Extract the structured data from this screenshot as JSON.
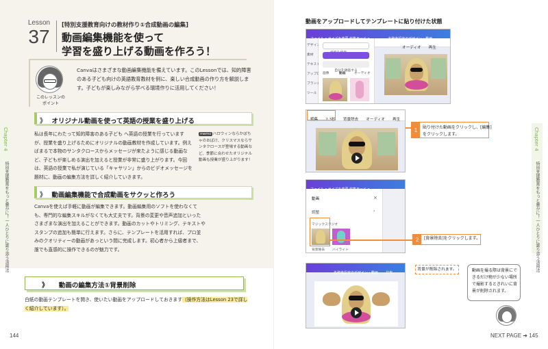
{
  "lesson": {
    "label": "Lesson",
    "number": "37",
    "subtitle": "[特別支援教育向けの教材作り①合成動画の編集]",
    "title_line1": "動画編集機能を使って",
    "title_line2": "学習を盛り上げる動画を作ろう！"
  },
  "intro": {
    "text": "Canvaはさまざまな動画編集機能を備えています。このLessonでは、知的障害のある子ども向けの英語教育教材を例に、楽しい合成動画の作り方を解説します。子どもが楽しみながら学べる環境作りに活用してください！",
    "point_label": "このレッスンのポイント"
  },
  "section1": {
    "mark": "》",
    "title": "オリジナル動画を使って英語の授業を盛り上げる",
    "body": "私は長年にわたって知的障害のある子ども へ英語の授業を行っていますが、授業を盛り上げるためにオリジナルの動画教材を作成しています。例えばまるで本物のサンタクロースからメッセージが来たように感じる動画など、子どもが楽しめる演出を加えると授業が非常に盛り上がります。今回は、英語の授業で私が演じている「キャサリン」からのビデオメッセージを題材に、動画の編集方法を詳しく紹介していきます。",
    "memo_tag": "memo",
    "memo": "ハロウィンならかぼちゃのおばけ、クリスマスならサンタクロースが登場する動画など、季節に合わせたオリジナル動画も授業が盛り上がります！"
  },
  "section2": {
    "mark": "》",
    "title": "動画編集機能で合成動画をサクッと作ろう",
    "body": "Canvaを使えば手軽に動画が編集できます。動画編集用のソフトを使わなくても、専門的な編集スキルがなくても大丈夫です。背景の変更や音声追加といったさまざまな演出を加えることができます。動画のカットやトリミング、テキストやスタンプの追加も簡単に行えます。さらに、テンプレートを活用すれば、プロ並みのクオリティーの動画があっという間に完成します。初心者から上級者まで、誰でも直感的に操作できるのが魅力です。"
  },
  "section3": {
    "mark": "》",
    "title": "動画の編集方法①背景削除",
    "body_line1": "白紙の動画テンプレートを開き、使いたい動画をアップロードしておきます",
    "body_highlight": "（操作方法はLesson 23で詳しく紹介しています）。"
  },
  "chapter": {
    "label": "Chapter 4",
    "description": "特別支援教育をもっと豊かに！一人ひとりに寄り添う活用法"
  },
  "folio": {
    "left": "144",
    "right_next": "NEXT PAGE",
    "right_arrow": "➜",
    "right": "145"
  },
  "right": {
    "title": "動画をアップロードしてテンプレートに貼り付けた状態",
    "shot1": {
      "bar": "ファイル ▾ サイズを変更  編集モード ▾",
      "doc_title": "名称未設定のデザイン・動画",
      "search_placeholder": "検索を検索",
      "upload_button": "ファイルをアップロード",
      "record_button": "自分を録画する",
      "tabs": [
        "画像",
        "動画",
        "オーディオ"
      ],
      "side_items": [
        "デザイン",
        "素材",
        "テキスト",
        "アップロード",
        "ブランド",
        "ツール"
      ],
      "toolbar": [
        "オーディオ",
        "再生"
      ]
    },
    "shot2": {
      "toolbar": [
        "編集",
        "2.3秒",
        "背景除去",
        "オーディオ",
        "再生"
      ]
    },
    "shot3": {
      "bar": "ファイル ▾ サイズを変更  編集モード ▾",
      "panel_title": "動画",
      "panel_item": "調整",
      "magic_studio": "マジックスタジオ",
      "thumb1": "背景除去",
      "thumb2": "ハイライト"
    },
    "shot4": {
      "doc_title": "名称未設定のデザイン・動画",
      "share": "共有"
    },
    "callout1_num": "1",
    "callout1_line1": "貼り付けた動画をクリックし、[編集]",
    "callout1_line2": "をクリックします。",
    "callout2_num": "2",
    "callout2_text": "[背景除去]をクリックします。",
    "removed_note": "背景が削除されます。",
    "bubble": "動画を撮る際は背景にできるだけ物が少ない場所で撮影するときれいに背景が削除されます。"
  }
}
